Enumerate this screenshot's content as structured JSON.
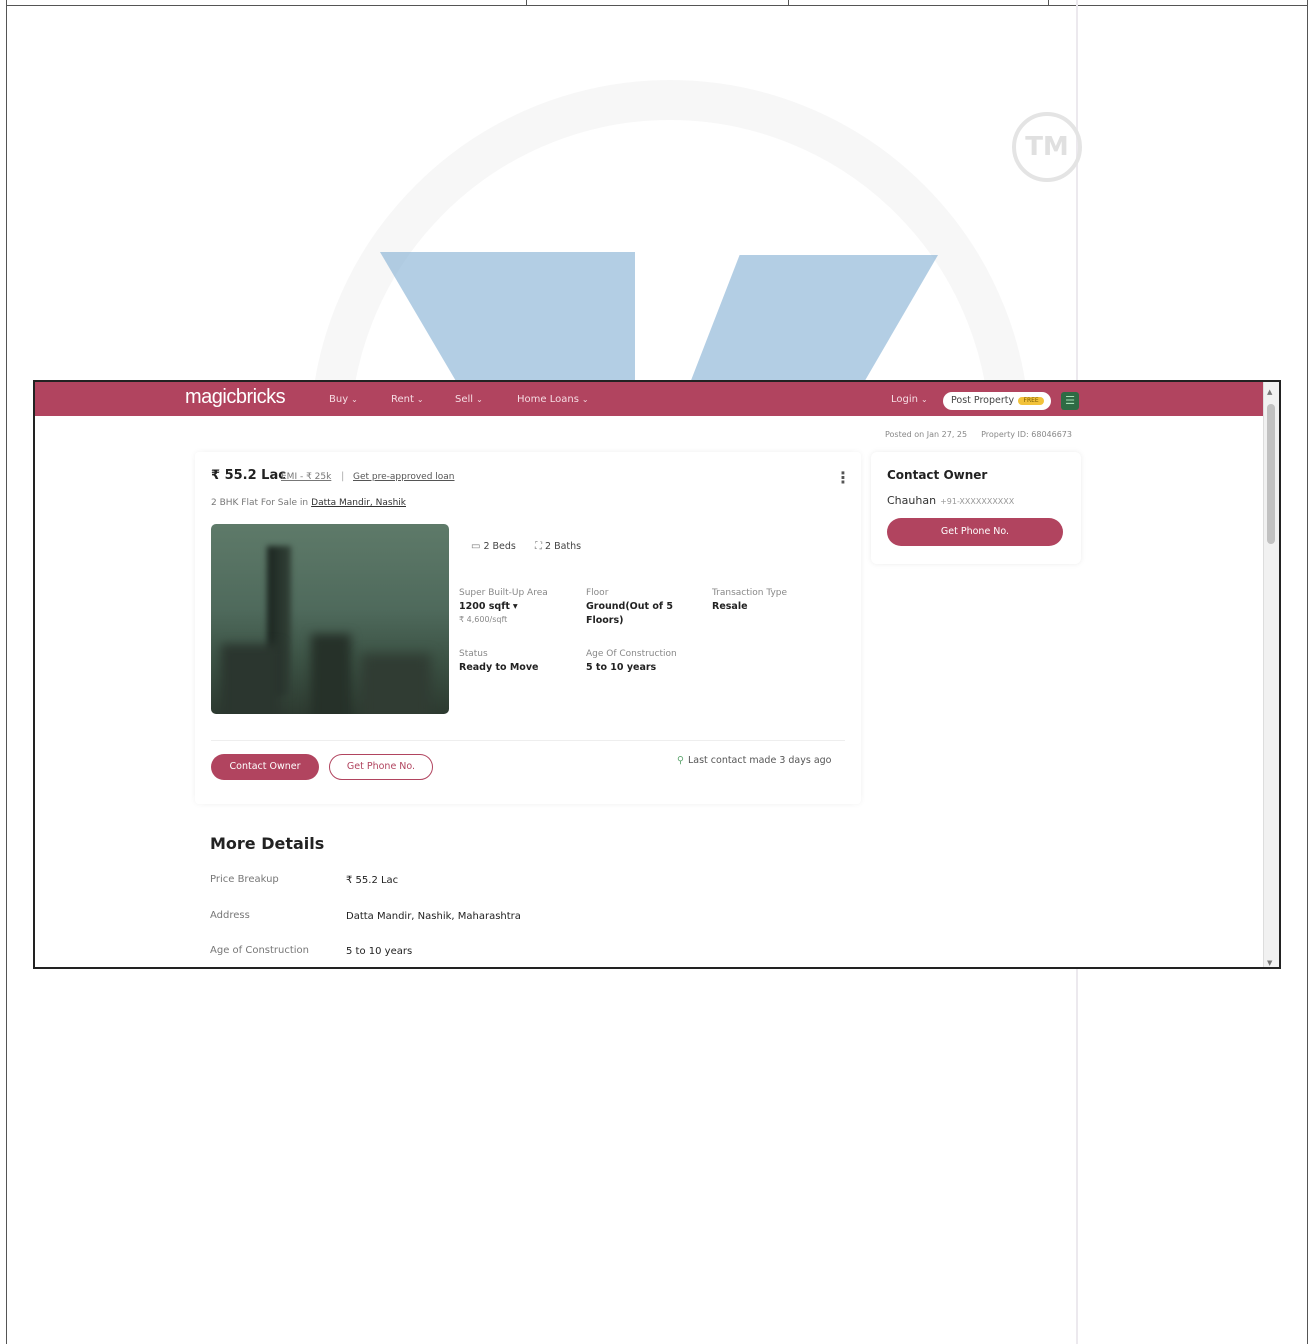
{
  "watermark": {
    "tm_mark": "TM"
  },
  "nav": {
    "logo": "magicbricks",
    "items": [
      {
        "label": "Buy"
      },
      {
        "label": "Rent"
      },
      {
        "label": "Sell"
      },
      {
        "label": "Home Loans"
      }
    ],
    "login": "Login",
    "post_property": "Post Property",
    "post_badge": "FREE",
    "menu_icon": "hamburger-icon"
  },
  "meta": {
    "posted_on": "Posted on Jan 27, 25",
    "property_id": "Property ID: 68046673"
  },
  "listing": {
    "price": "₹ 55.2 Lac",
    "emi": "EMI - ₹ 25k",
    "separator": "|",
    "preapproved_loan": "Get pre-approved loan",
    "subtitle_prefix": "2 BHK Flat For Sale in",
    "locality": "Datta Mandir, Nashik",
    "beds": "2 Beds",
    "baths": "2 Baths",
    "specs": [
      {
        "label": "Super Built-Up Area",
        "value": "1200 sqft",
        "sub": "₹ 4,600/sqft"
      },
      {
        "label": "Floor",
        "value": "Ground(Out of 5 Floors)"
      },
      {
        "label": "Transaction Type",
        "value": "Resale"
      },
      {
        "label": "Status",
        "value": "Ready to Move"
      },
      {
        "label": "Age Of Construction",
        "value": "5 to 10 years"
      }
    ],
    "contact_owner_label": "Contact Owner",
    "get_phone_label": "Get Phone No.",
    "last_contact": "Last contact made 3 days ago"
  },
  "owner": {
    "title": "Contact Owner",
    "name": "Chauhan",
    "masked_phone": "+91-XXXXXXXXXX",
    "button": "Get Phone No."
  },
  "more_details": {
    "title": "More Details",
    "rows": [
      {
        "label": "Price Breakup",
        "value": "₹ 55.2 Lac"
      },
      {
        "label": "Address",
        "value": "Datta Mandir, Nashik, Maharashtra"
      },
      {
        "label": "Age of Construction",
        "value": "5 to 10 years"
      }
    ]
  },
  "colors": {
    "brand": "#b1445f",
    "watermark_blue": "#8ab4d6",
    "menu_green": "#2e6b44"
  }
}
